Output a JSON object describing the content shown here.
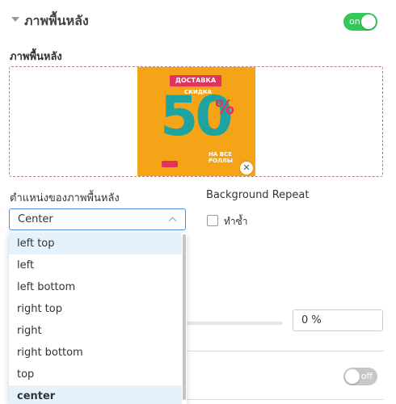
{
  "section": {
    "title": "ภาพพื้นหลัง",
    "toggle_label": "on"
  },
  "background_image": {
    "label": "ภาพพื้นหลัง",
    "poster": {
      "banner": "ДОСТАВКА",
      "sub": "СКИДКА",
      "big": "50",
      "pct": "%",
      "bottom": "НА ВСЕ РОЛЛЫ"
    }
  },
  "position": {
    "label": "ตำแหน่งของภาพพื้นหลัง",
    "selected": "Center",
    "options": [
      "left top",
      "left",
      "left bottom",
      "right top",
      "right",
      "right bottom",
      "top",
      "center"
    ]
  },
  "repeat": {
    "label": "Background Repeat",
    "checkbox_label": "ทำซ้ำ",
    "checked": false
  },
  "opacity": {
    "value": "0 %"
  },
  "second_toggle": {
    "label": "off"
  },
  "colors": {
    "accent": "#34c759",
    "focus": "#4a90d9",
    "highlight": "#e6f2fb"
  }
}
